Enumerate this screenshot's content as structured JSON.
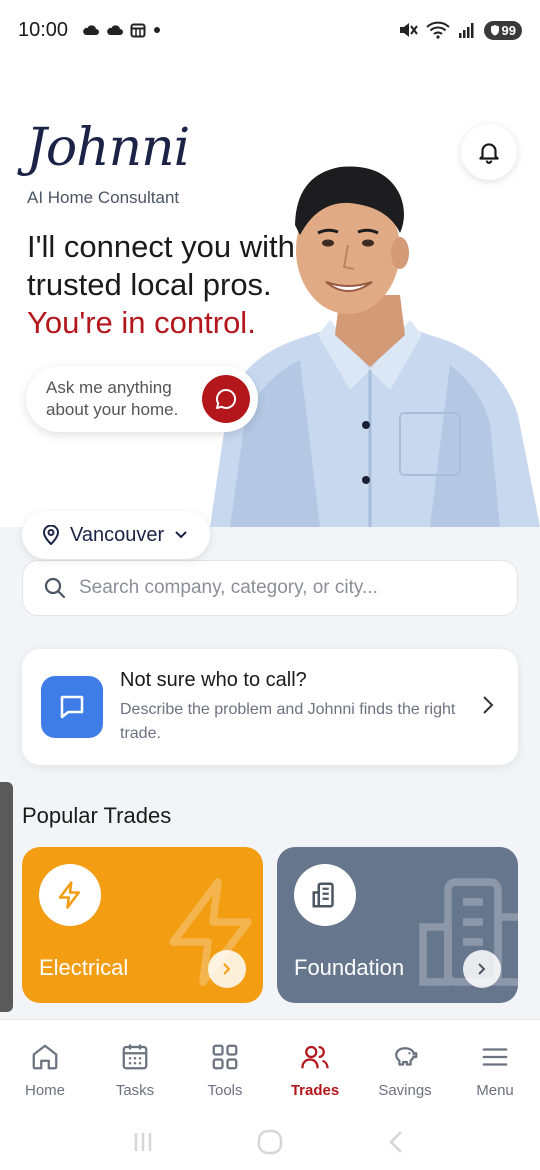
{
  "status_bar": {
    "time": "10:00",
    "left_icons": [
      "cloud-icon",
      "cloud-icon",
      "calendar-icon",
      "dot-icon"
    ],
    "right_icons": [
      "mute-icon",
      "wifi-icon",
      "signal-icon"
    ],
    "battery": "99"
  },
  "hero": {
    "brand": "Johnni",
    "subtitle": "AI Home Consultant",
    "headline": "I'll connect you with trusted local pros.",
    "accent": "You're in control.",
    "ask_text": "Ask me anything about your home."
  },
  "location": {
    "city": "Vancouver"
  },
  "search": {
    "placeholder": "Search company, category, or city..."
  },
  "help_card": {
    "title": "Not sure who to call?",
    "description": "Describe the problem and Johnni finds the right trade."
  },
  "popular": {
    "title": "Popular Trades",
    "trades": [
      {
        "label": "Electrical",
        "color": "#f29d12"
      },
      {
        "label": "Foundation",
        "color": "#66768d"
      }
    ]
  },
  "bottom_nav": {
    "items": [
      {
        "label": "Home"
      },
      {
        "label": "Tasks"
      },
      {
        "label": "Tools"
      },
      {
        "label": "Trades"
      },
      {
        "label": "Savings"
      },
      {
        "label": "Menu"
      }
    ],
    "active": "Trades"
  },
  "colors": {
    "accent": "#b3171c",
    "brand_navy": "#1b2346",
    "chat_blue": "#3e7ce8"
  }
}
